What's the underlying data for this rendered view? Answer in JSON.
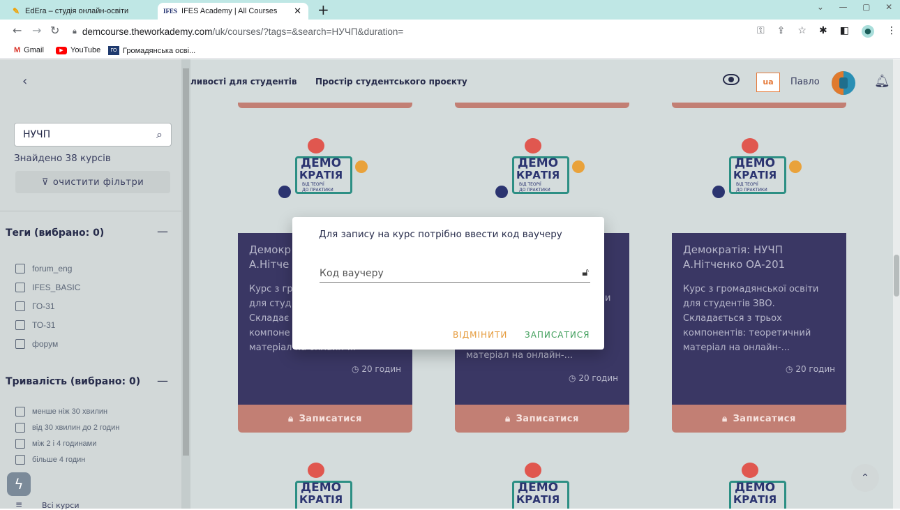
{
  "browser": {
    "tabs": [
      {
        "favicon": "pencil-icon",
        "title": "EdEra – студія онлайн-освіти",
        "close": "✕"
      },
      {
        "favicon_text": "IFES",
        "title": "IFES Academy | All Courses",
        "close": "✕"
      }
    ],
    "new_tab": "+",
    "url_host": "demcourse.theworkademy.com",
    "url_path": "/uk/courses/?tags=&search=НУЧП&duration=",
    "bookmarks": [
      {
        "icon": "gmail-icon",
        "label": "Gmail"
      },
      {
        "icon": "youtube-icon",
        "label": "YouTube"
      },
      {
        "icon_text": "ГО",
        "label": "Громадянська осві..."
      }
    ]
  },
  "header": {
    "nav_partial": "ливості для студентів",
    "nav_project": "Простір студентського проєкту",
    "lang": "ua",
    "user_name": "Павло"
  },
  "sidebar": {
    "search_value": "НУЧП",
    "found": "Знайдено 38 курсів",
    "clear_filters": "очистити фільтри",
    "tags_title": "Теги (вибрано: 0)",
    "tags": [
      "forum_eng",
      "IFES_BASIC",
      "ГО-31",
      "ТО-31",
      "форум"
    ],
    "duration_title": "Тривалість (вибрано: 0)",
    "durations": [
      "менше ніж 30 хвилин",
      "від 30 хвилин до 2 годин",
      "між 2 і 4 годинами",
      "більше 4 годин"
    ],
    "all_courses": "Всі курси"
  },
  "logo": {
    "line1": "ДЕМО",
    "line2": "КРАТІЯ",
    "sub1": "ВІД ТЕОРІЇ",
    "sub2": "ДО ПРАКТИКИ"
  },
  "cards": [
    {
      "title1": "Демокр",
      "title2": "А.Нітче",
      "desc": [
        "Курс з гр",
        "для студ",
        "Складає",
        "компоне",
        "матеріал на онлайн-..."
      ],
      "duration": "20 годин",
      "enroll": "Записатися"
    },
    {
      "title1": "",
      "title2": "",
      "desc": [
        "",
        "",
        "",
        "",
        "матеріал на онлайн-..."
      ],
      "desc_fragment": "и",
      "duration": "20 годин",
      "enroll": "Записатися"
    },
    {
      "title1": "Демократія: НУЧП",
      "title2": "А.Нітченко ОА-201",
      "desc": [
        "Курс з громадянської освіти",
        "для студентів ЗВО.",
        "Складається з трьох",
        "компонентів: теоретичний",
        "матеріал на онлайн-..."
      ],
      "duration": "20 годин",
      "enroll": "Записатися"
    }
  ],
  "modal": {
    "title": "Для запису на курс потрібно ввести код ваучеру",
    "placeholder": "Код ваучеру",
    "cancel": "ВІДМІНИТИ",
    "submit": "ЗАПИСАТИСЯ"
  },
  "colors": {
    "accent_green": "#3f9e5a",
    "accent_orange": "#e59a3a",
    "card_purple": "#3a3764",
    "enroll": "#c27f74"
  }
}
